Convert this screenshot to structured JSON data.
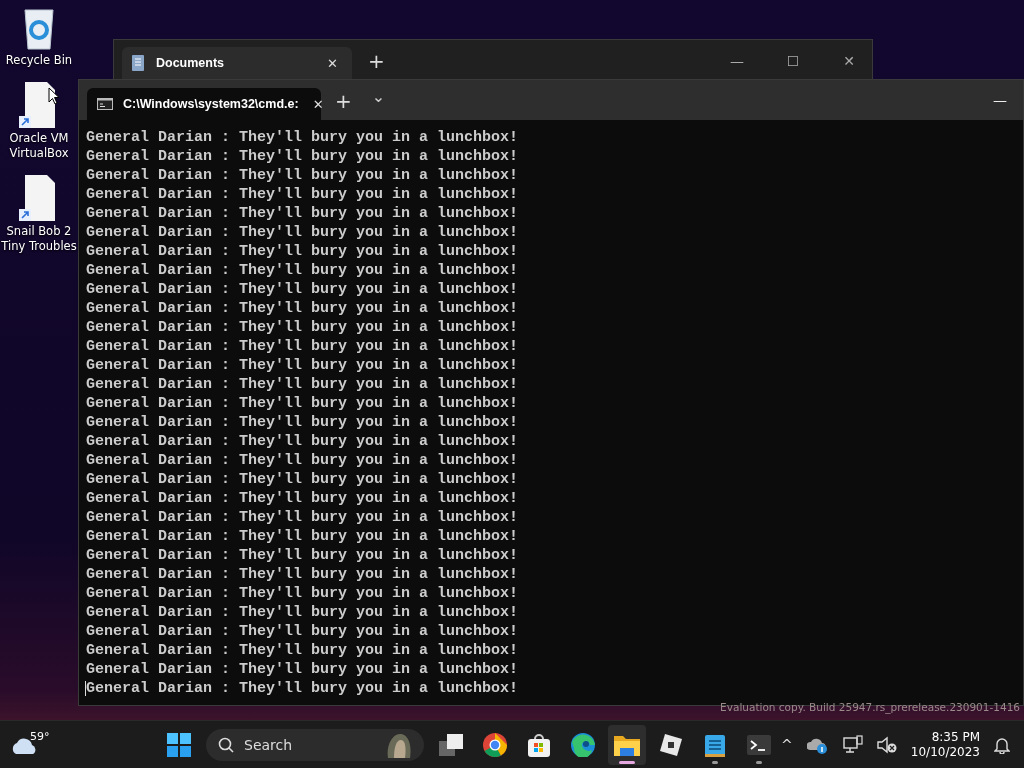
{
  "desktop_icons": [
    {
      "kind": "recycle",
      "label": "Recycle Bin"
    },
    {
      "kind": "shortcut",
      "label": "Oracle VM VirtualBox"
    },
    {
      "kind": "shortcut",
      "label": "Snail Bob 2 Tiny Troubles"
    }
  ],
  "explorer_window": {
    "tab": {
      "title": "Documents",
      "close": "✕"
    },
    "new_tab": "+",
    "controls": [
      "—",
      "☐",
      "✕"
    ]
  },
  "terminal_window": {
    "tab": {
      "title": "C:\\Windows\\system32\\cmd.e:",
      "close": "✕"
    },
    "new_tab": "+",
    "dropdown": "⌄",
    "minimize": "—",
    "lines": [
      "General Darian : They'll bury you in a lunchbox!",
      "General Darian : They'll bury you in a lunchbox!",
      "General Darian : They'll bury you in a lunchbox!",
      "General Darian : They'll bury you in a lunchbox!",
      "General Darian : They'll bury you in a lunchbox!",
      "General Darian : They'll bury you in a lunchbox!",
      "General Darian : They'll bury you in a lunchbox!",
      "General Darian : They'll bury you in a lunchbox!",
      "General Darian : They'll bury you in a lunchbox!",
      "General Darian : They'll bury you in a lunchbox!",
      "General Darian : They'll bury you in a lunchbox!",
      "General Darian : They'll bury you in a lunchbox!",
      "General Darian : They'll bury you in a lunchbox!",
      "General Darian : They'll bury you in a lunchbox!",
      "General Darian : They'll bury you in a lunchbox!",
      "General Darian : They'll bury you in a lunchbox!",
      "General Darian : They'll bury you in a lunchbox!",
      "General Darian : They'll bury you in a lunchbox!",
      "General Darian : They'll bury you in a lunchbox!",
      "General Darian : They'll bury you in a lunchbox!",
      "General Darian : They'll bury you in a lunchbox!",
      "General Darian : They'll bury you in a lunchbox!",
      "General Darian : They'll bury you in a lunchbox!",
      "General Darian : They'll bury you in a lunchbox!",
      "General Darian : They'll bury you in a lunchbox!",
      "General Darian : They'll bury you in a lunchbox!",
      "General Darian : They'll bury you in a lunchbox!",
      "General Darian : They'll bury you in a lunchbox!",
      "General Darian : They'll bury you in a lunchbox!",
      "General Darian : They'll bury you in a lunchbox!"
    ]
  },
  "watermark_text": "Evaluation copy. Build 25947.rs_prerelease.230901-1416",
  "taskbar": {
    "weather": {
      "temperature": "59°"
    },
    "search": {
      "label": "Search"
    },
    "apps": [
      {
        "kind": "start",
        "running": false,
        "selected": false
      },
      {
        "kind": "taskview",
        "running": false,
        "selected": false
      },
      {
        "kind": "chrome",
        "running": false,
        "selected": false
      },
      {
        "kind": "store",
        "running": false,
        "selected": false
      },
      {
        "kind": "edge",
        "running": false,
        "selected": false
      },
      {
        "kind": "explorer",
        "running": true,
        "selected": true
      },
      {
        "kind": "roblox",
        "running": false,
        "selected": false
      },
      {
        "kind": "notepad",
        "running": true,
        "selected": false
      },
      {
        "kind": "terminal",
        "running": true,
        "selected": false
      }
    ],
    "tray_chevron": "^",
    "clock": {
      "time": "8:35 PM",
      "date": "10/10/2023"
    }
  }
}
